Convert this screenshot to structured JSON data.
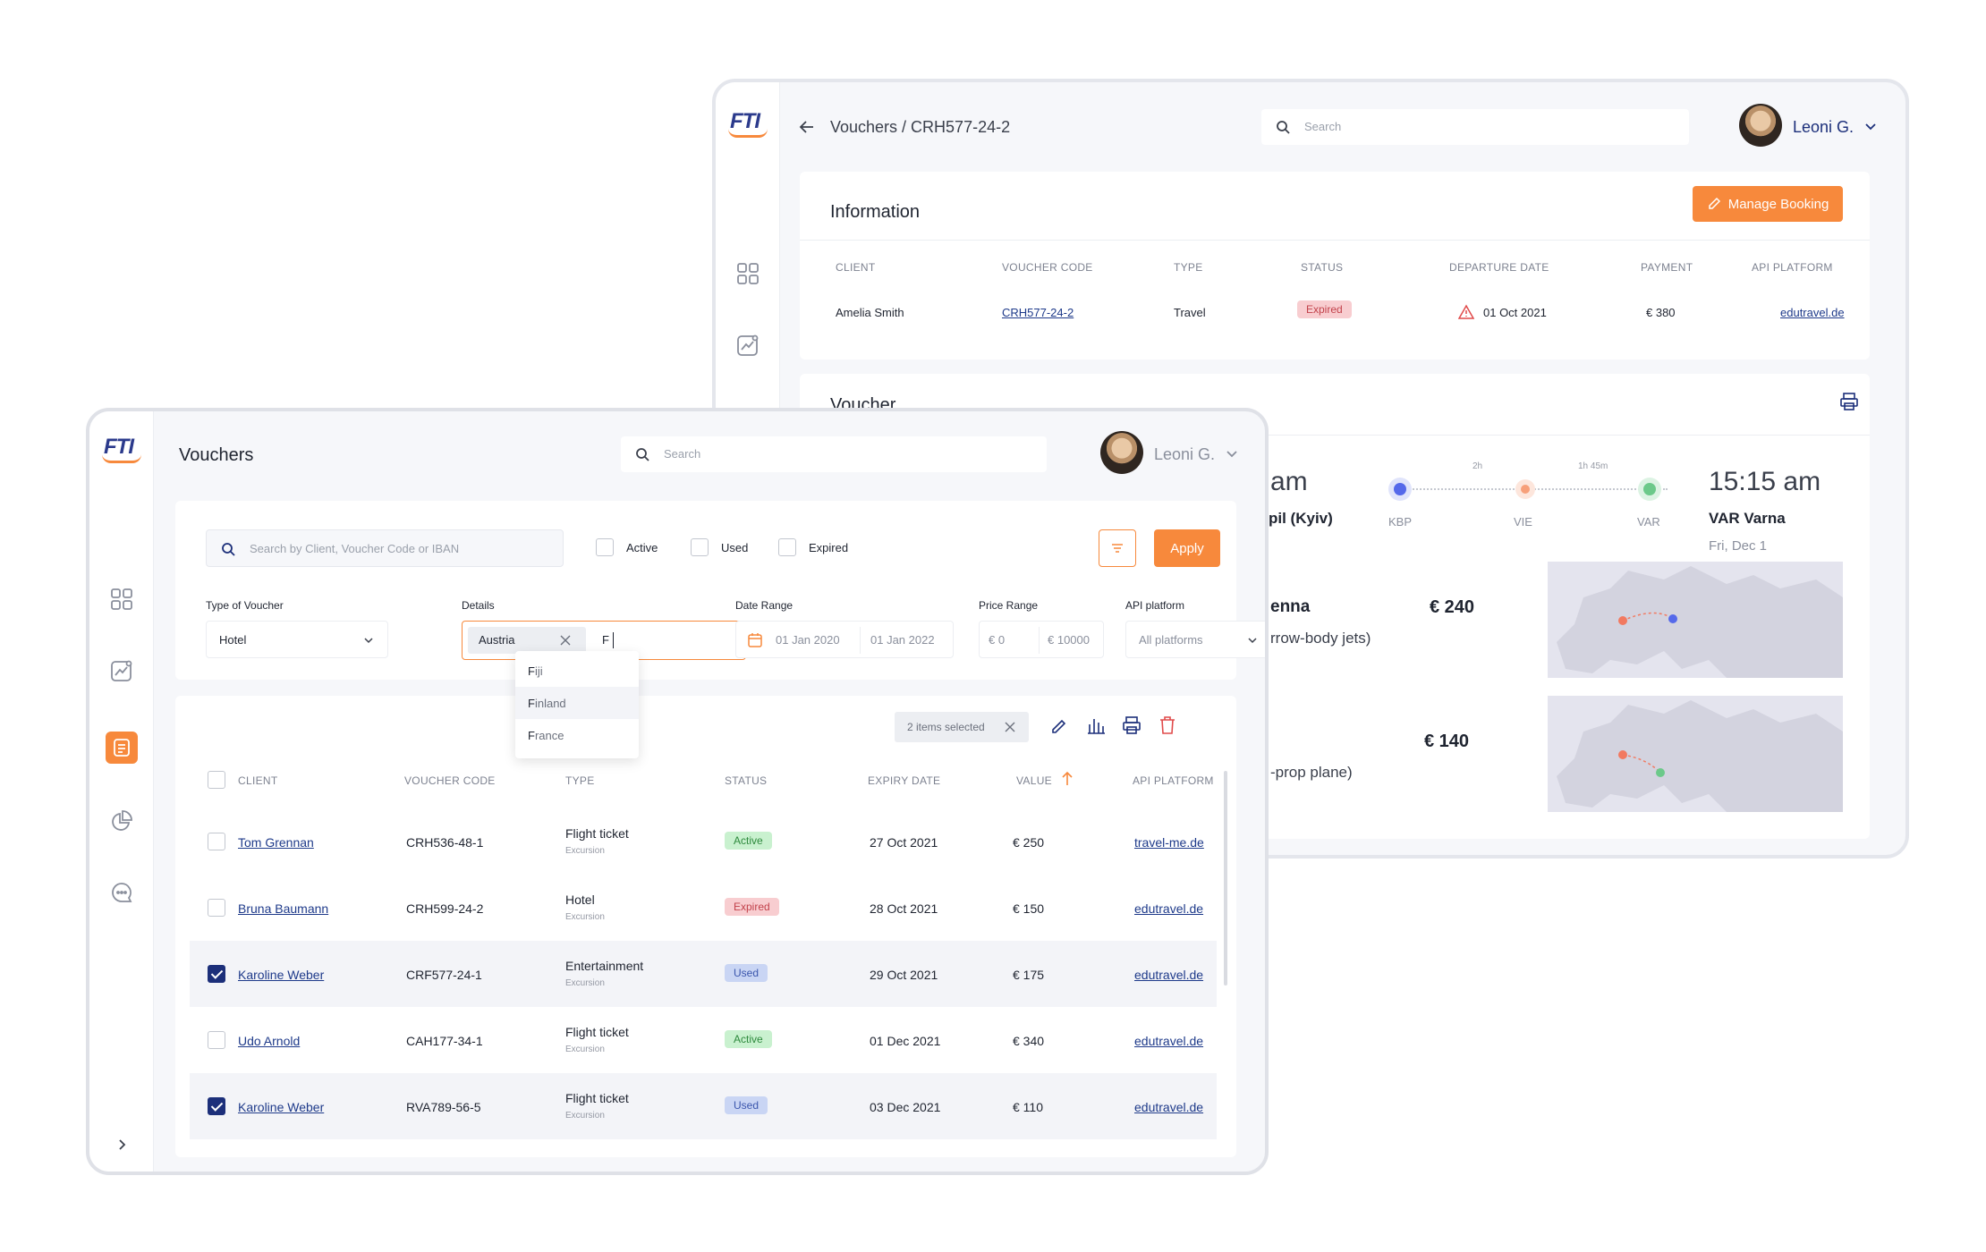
{
  "back_window": {
    "logo": "FTI",
    "breadcrumb": "Vouchers / CRH577-24-2",
    "search_placeholder": "Search",
    "user_name": "Leoni G.",
    "info_title": "Information",
    "manage_button": "Manage Booking",
    "info_headers": [
      "CLIENT",
      "VOUCHER CODE",
      "TYPE",
      "STATUS",
      "DEPARTURE DATE",
      "PAYMENT",
      "API PLATFORM"
    ],
    "info_row": {
      "client": "Amelia Smith",
      "voucher_code": "CRH577-24-2",
      "type": "Travel",
      "status": "Expired",
      "departure_date": "01 Oct 2021",
      "payment": "€ 380",
      "api_platform": "edutravel.de"
    },
    "voucher_title": "Voucher",
    "route": {
      "start_time_partial": "am",
      "start_place_partial": "pil (Kyiv)",
      "stops": [
        "KBP",
        "VIE",
        "VAR"
      ],
      "durations": [
        "2h",
        "1h 45m"
      ],
      "end_time": "15:15 am",
      "end_place": "VAR Varna",
      "end_date": "Fri, Dec 1"
    },
    "flights": [
      {
        "name_partial": "enna",
        "price": "€ 240",
        "desc_partial": "rrow-body jets)"
      },
      {
        "name_partial": "",
        "price": "€ 140",
        "desc_partial": "-prop plane)"
      }
    ],
    "colors": {
      "kbp": "#5569ea",
      "vie": "#f7a07a",
      "var": "#6cc98a",
      "map_bg": "#e4e4ee"
    }
  },
  "front_window": {
    "logo": "FTI",
    "page_title": "Vouchers",
    "search_placeholder": "Search",
    "user_name": "Leoni G.",
    "filter_search_placeholder": "Search by Client, Voucher Code or IBAN",
    "status_filters": [
      "Active",
      "Used",
      "Expired"
    ],
    "apply_button": "Apply",
    "type_label": "Type of Voucher",
    "type_value": "Hotel",
    "details_label": "Details",
    "details_chip": "Austria",
    "details_typed": "F",
    "date_label": "Date Range",
    "date_from": "01 Jan 2020",
    "date_to": "01 Jan 2022",
    "price_label": "Price Range",
    "price_min": "€ 0",
    "price_max": "€ 10000",
    "api_label": "API platform",
    "api_value": "All platforms",
    "dropdown_options": [
      {
        "first": "F",
        "rest": "iji"
      },
      {
        "first": "F",
        "rest": "inland"
      },
      {
        "first": "F",
        "rest": "rance"
      }
    ],
    "selected_text": "2 items selected",
    "table_headers": [
      "CLIENT",
      "VOUCHER CODE",
      "TYPE",
      "STATUS",
      "EXPIRY DATE",
      "VALUE",
      "API PLATFORM"
    ],
    "rows": [
      {
        "checked": false,
        "client": "Tom Grennan",
        "code": "CRH536-48-1",
        "type": "Flight ticket",
        "subtype": "Excursion",
        "status": "Active",
        "expiry": "27 Oct 2021",
        "value": "€ 250",
        "platform": "travel-me.de"
      },
      {
        "checked": false,
        "client": "Bruna Baumann",
        "code": "CRH599-24-2",
        "type": "Hotel",
        "subtype": "Excursion",
        "status": "Expired",
        "expiry": "28 Oct 2021",
        "value": "€ 150",
        "platform": "edutravel.de"
      },
      {
        "checked": true,
        "client": "Karoline Weber",
        "code": "CRF577-24-1",
        "type": "Entertainment",
        "subtype": "Excursion",
        "status": "Used",
        "expiry": "29 Oct 2021",
        "value": "€ 175",
        "platform": "edutravel.de"
      },
      {
        "checked": false,
        "client": "Udo Arnold",
        "code": "CAH177-34-1",
        "type": "Flight ticket",
        "subtype": "Excursion",
        "status": "Active",
        "expiry": "01 Dec 2021",
        "value": "€ 340",
        "platform": "edutravel.de"
      },
      {
        "checked": true,
        "client": "Karoline Weber",
        "code": "RVA789-56-5",
        "type": "Flight ticket",
        "subtype": "Excursion",
        "status": "Used",
        "expiry": "03 Dec 2021",
        "value": "€ 110",
        "platform": "edutravel.de"
      }
    ],
    "colors": {
      "accent": "#f7893c",
      "navy": "#1c2f7a"
    }
  }
}
